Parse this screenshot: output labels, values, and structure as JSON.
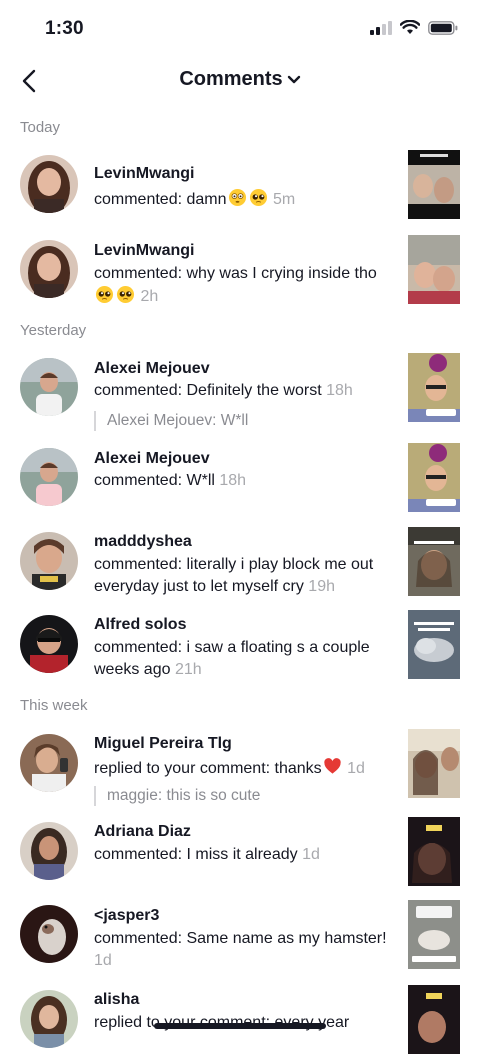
{
  "status": {
    "time": "1:30"
  },
  "header": {
    "title": "Comments"
  },
  "sections": {
    "today": "Today",
    "yesterday": "Yesterday",
    "this_week": "This week"
  },
  "items": [
    {
      "name": "LevinMwangi",
      "text": "commented: damn",
      "emoji": [
        "flushed-face",
        "pleading-face"
      ],
      "time": "5m"
    },
    {
      "name": "LevinMwangi",
      "text": "commented: why was I crying inside tho",
      "emoji": [
        "pleading-face",
        "pleading-face"
      ],
      "time": "2h"
    },
    {
      "name": "Alexei Mejouev",
      "text": "commented: Definitely the worst",
      "time": "18h",
      "reply": "Alexei Mejouev: W*ll"
    },
    {
      "name": "Alexei Mejouev",
      "text": "commented: W*ll",
      "time": "18h"
    },
    {
      "name": "madddyshea",
      "text": "commented: literally i play block me out everyday just to let myself cry",
      "time": "19h"
    },
    {
      "name": "Alfred solos",
      "text": "commented: i saw a floating s a couple weeks ago",
      "time": "21h"
    },
    {
      "name": "Miguel Pereira Tlg",
      "text": "replied to your comment: thanks",
      "emoji": [
        "red-heart"
      ],
      "time": "1d",
      "reply": "maggie: this is so cute"
    },
    {
      "name": "Adriana Diaz",
      "text": "commented: I miss it already",
      "time": "1d"
    },
    {
      "name": "<jasper3",
      "text": "commented: Same name as my hamster!",
      "time": "1d"
    },
    {
      "name": "alisha",
      "text": "replied to your comment: every year"
    }
  ]
}
